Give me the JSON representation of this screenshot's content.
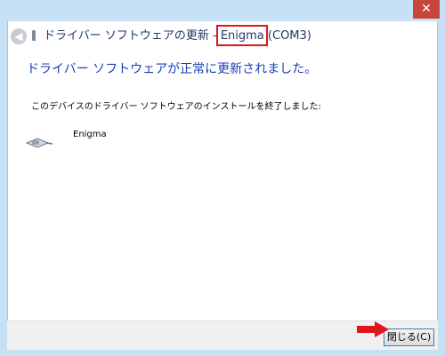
{
  "window": {
    "title": "ドライバー ソフトウェアの更新 - Enigma ",
    "title_highlight": "(COM3)",
    "close_glyph": "✕",
    "back_glyph": "◀"
  },
  "main": {
    "heading": "ドライバー ソフトウェアが正常に更新されました。",
    "subtext": "このデバイスのドライバー ソフトウェアのインストールを終了しました:",
    "device_name": "Enigma"
  },
  "footer": {
    "close_label": "閉じる(C)"
  },
  "colors": {
    "accent": "#1a3fb5",
    "highlight_box": "#e0161c",
    "arrow": "#e0161c",
    "frame": "#c6e0f6"
  }
}
